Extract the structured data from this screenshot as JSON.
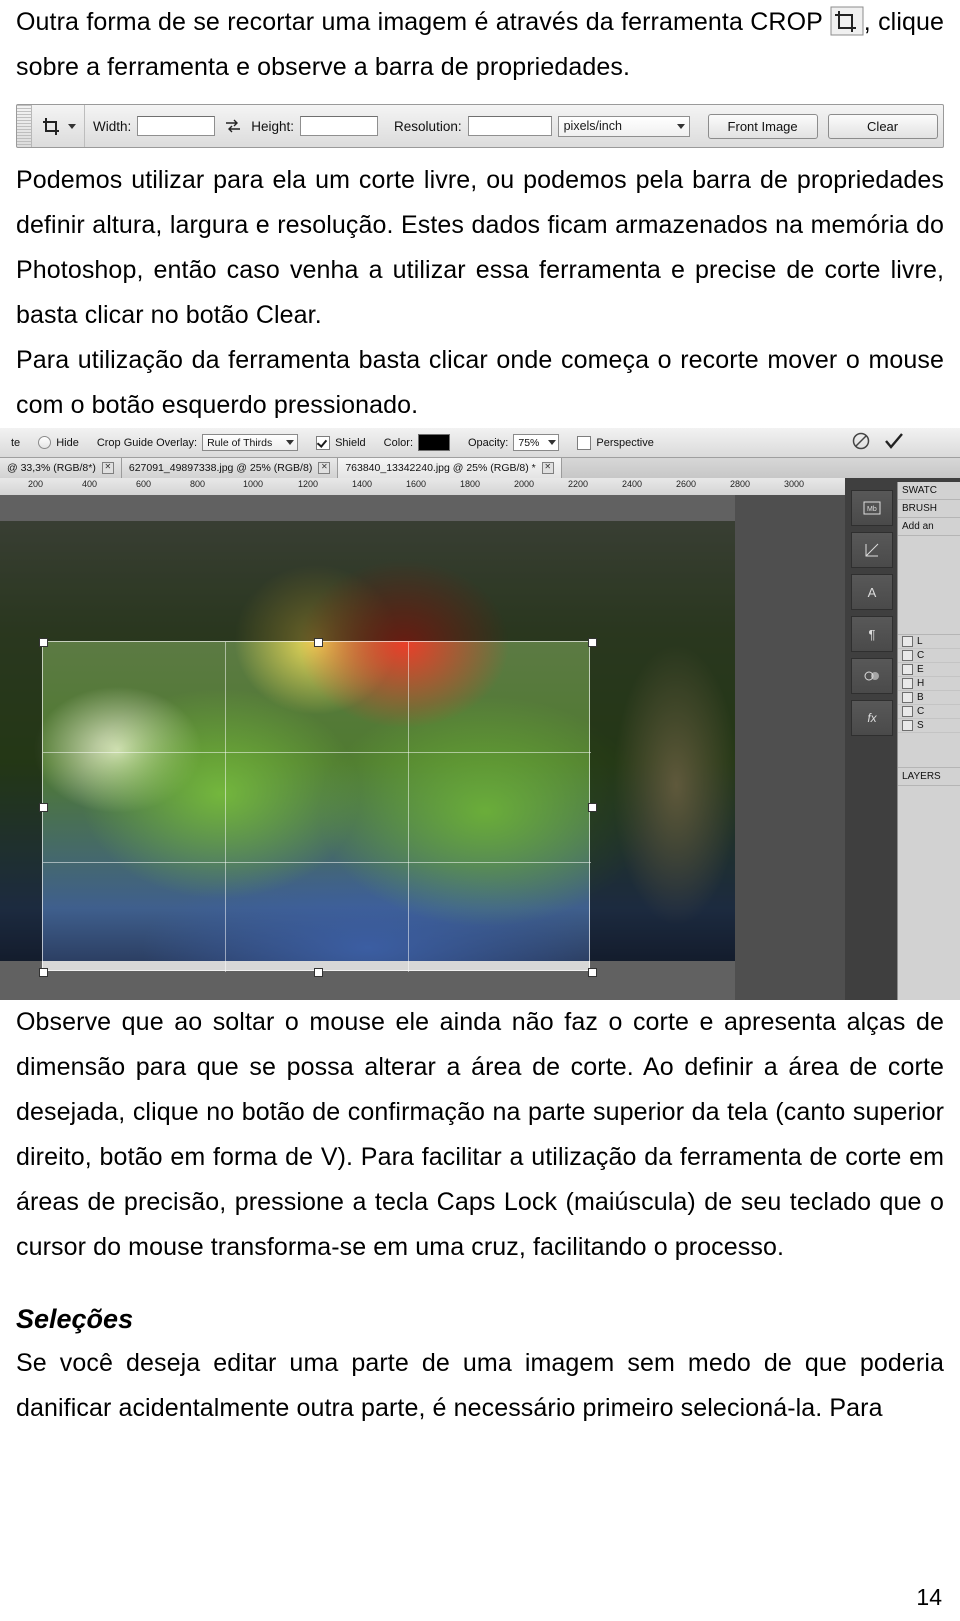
{
  "document": {
    "page_number": "14",
    "paragraphs": {
      "intro": "Outra forma de se recortar uma imagem é através da ferramenta CROP",
      "intro_tail": ",",
      "intro_line2": "clique sobre a ferramenta e observe a barra de propriedades.",
      "after_bar": "Podemos utilizar para ela um corte livre, ou podemos pela barra de propriedades definir altura, largura e resolução. Estes dados ficam armazenados na memória do Photoshop, então caso venha a utilizar essa ferramenta e precise de corte livre, basta clicar no botão Clear.",
      "after_bar2": "Para utilização da ferramenta basta clicar onde começa o recorte mover o mouse com o botão esquerdo pressionado.",
      "after_shot": "Observe que ao soltar o mouse ele ainda não faz o corte e apresenta alças de dimensão para que se possa alterar a área de corte. Ao definir a área de corte desejada, clique no botão de confirmação na parte superior da tela (canto superior direito, botão em forma de V). Para facilitar a utilização da ferramenta de corte em áreas de precisão, pressione a tecla Caps Lock (maiúscula) de seu teclado que o cursor do mouse transforma-se em uma cruz, facilitando o processo.",
      "selecoes_heading": "Seleções",
      "selecoes_body": "Se você deseja editar uma parte de uma imagem sem medo de que poderia danificar acidentalmente outra parte, é necessário primeiro selecioná-la. Para"
    }
  },
  "options_bar": {
    "tool_icon": "crop-tool-icon",
    "width_label": "Width:",
    "width_value": "",
    "swap_icon": "swap-width-height-icon",
    "height_label": "Height:",
    "height_value": "",
    "resolution_label": "Resolution:",
    "resolution_value": "",
    "resolution_unit": "pixels/inch",
    "front_image_button": "Front Image",
    "clear_button": "Clear"
  },
  "screenshot": {
    "options_bar2": {
      "left_fragment": "te",
      "hide_label": "Hide",
      "crop_guide_overlay_label": "Crop Guide Overlay:",
      "crop_guide_overlay_value": "Rule of Thirds",
      "shield_label": "Shield",
      "color_label": "Color:",
      "color_value": "#000000",
      "opacity_label": "Opacity:",
      "opacity_value": "75%",
      "perspective_label": "Perspective",
      "cancel_icon": "cancel-crop-icon",
      "commit_icon": "commit-crop-checkmark-icon"
    },
    "tabs": [
      {
        "label": "@ 33,3% (RGB/8*)",
        "active": false
      },
      {
        "label": "627091_49897338.jpg @ 25% (RGB/8)",
        "active": false
      },
      {
        "label": "763840_13342240.jpg @ 25% (RGB/8) *",
        "active": true
      }
    ],
    "ruler_ticks": [
      "200",
      "400",
      "600",
      "800",
      "1000",
      "1200",
      "1400",
      "1600",
      "1800",
      "2000",
      "2200",
      "2400",
      "2600",
      "2800",
      "3000"
    ],
    "right_dock": {
      "collapse_icon": "collapse-panels-icon",
      "panel_labels": [
        "SWATC",
        "BRUSH",
        "Add an"
      ],
      "tool_icons": [
        "mini-bridge-icon",
        "measure-icon",
        "text-icon",
        "paragraph-icon",
        "adjustments-icon",
        "fx-icon"
      ],
      "list_items": [
        "L",
        "C",
        "E",
        "H",
        "B",
        "C",
        "S"
      ],
      "layers_label": "LAYERS"
    }
  }
}
